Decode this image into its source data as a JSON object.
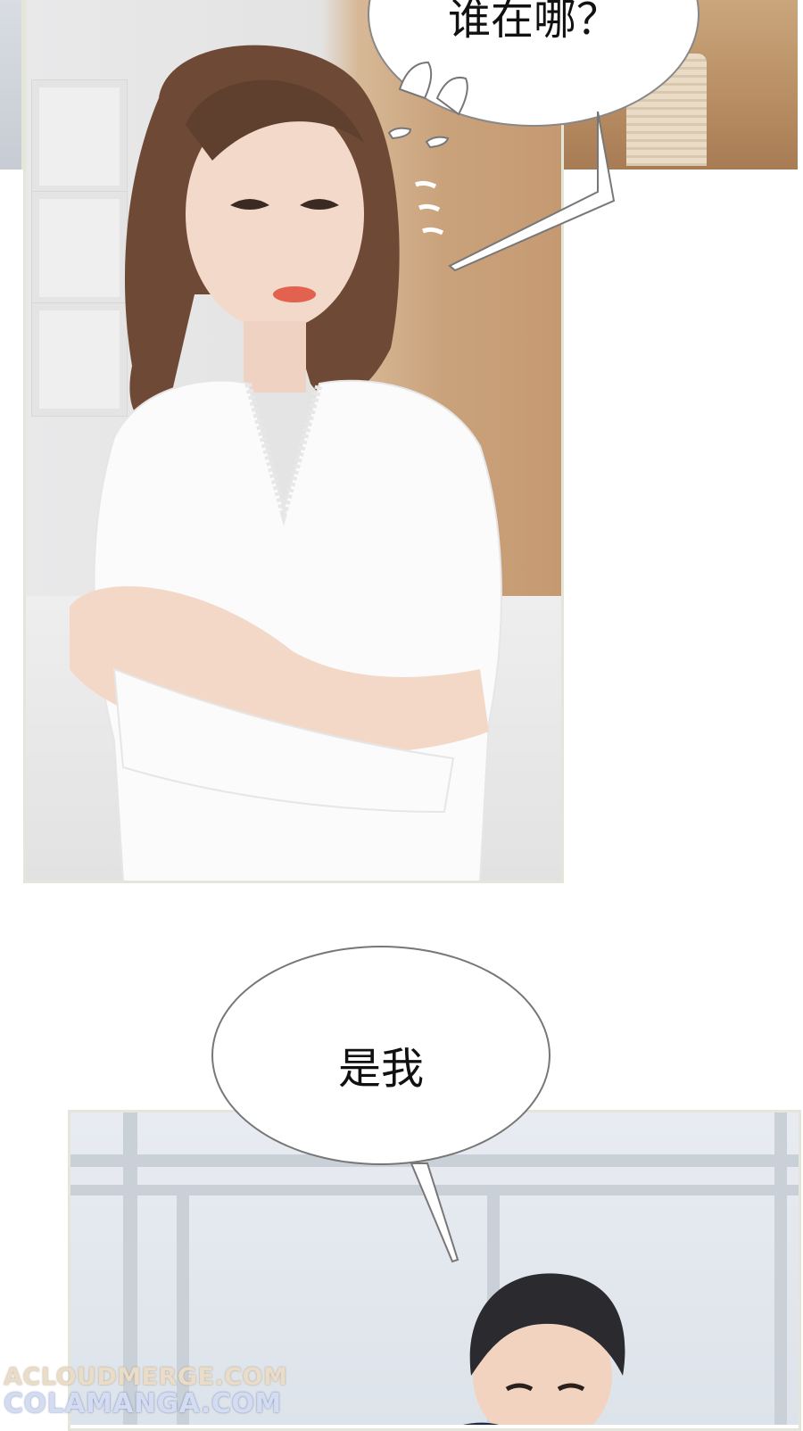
{
  "top_bubble": {
    "text": "谁在哪？"
  },
  "middle_bubble": {
    "text": "是我"
  },
  "watermark": {
    "line1": "ACLOUDMERGE.COM",
    "line2": "COLAMANGA.COM"
  },
  "colors": {
    "panel_border": "#e3e6d8",
    "bubble_outline": "#777777",
    "wood_wall": "#c59a72",
    "window_frame": "#c9d0d8"
  }
}
